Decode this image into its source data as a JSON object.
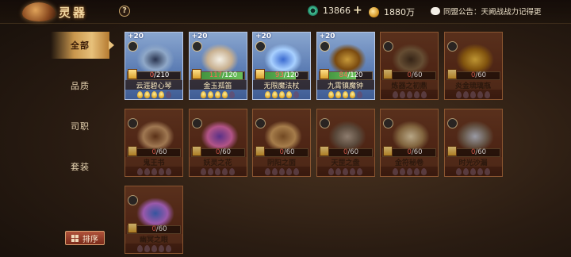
{
  "header": {
    "title": "灵器",
    "help_icon": "?",
    "jade_amount": "13866",
    "gold_amount": "1880万",
    "notice": "同盟公告：天阙战战力记得更"
  },
  "nav": {
    "items": [
      {
        "label": "全部",
        "active": true
      },
      {
        "label": "品质",
        "active": false
      },
      {
        "label": "司职",
        "active": false
      },
      {
        "label": "套装",
        "active": false
      }
    ],
    "sort_label": "排序"
  },
  "cards": [
    {
      "name": "云涯碧心琴",
      "upgrade": "+20",
      "current": "0",
      "max": "210",
      "progress": 0,
      "stars": 5,
      "owned": true,
      "icon": "qin-zither-icon"
    },
    {
      "name": "金玉孤笛",
      "upgrade": "+20",
      "current": "117",
      "max": "120",
      "progress": 0.97,
      "stars": 5,
      "owned": true,
      "icon": "flower-flute-icon"
    },
    {
      "name": "无限魔法杖",
      "upgrade": "+20",
      "current": "93",
      "max": "120",
      "progress": 0.77,
      "stars": 5,
      "owned": true,
      "icon": "magic-staff-icon"
    },
    {
      "name": "九霄镇魔钟",
      "upgrade": "+20",
      "current": "84",
      "max": "120",
      "progress": 0.7,
      "stars": 5,
      "owned": true,
      "icon": "bell-icon"
    },
    {
      "name": "炼器之初鼎",
      "upgrade": "",
      "current": "0",
      "max": "60",
      "progress": 0,
      "stars": 5,
      "owned": false,
      "icon": "cauldron-icon"
    },
    {
      "name": "炎金琉璃瓶",
      "upgrade": "",
      "current": "0",
      "max": "60",
      "progress": 0,
      "stars": 5,
      "owned": false,
      "icon": "gold-vase-icon"
    },
    {
      "name": "鬼王书",
      "upgrade": "",
      "current": "0",
      "max": "60",
      "progress": 0,
      "stars": 5,
      "owned": false,
      "icon": "book-icon"
    },
    {
      "name": "妖灵之花",
      "upgrade": "",
      "current": "0",
      "max": "60",
      "progress": 0,
      "stars": 5,
      "owned": false,
      "icon": "demon-flower-icon"
    },
    {
      "name": "阴阳之面",
      "upgrade": "",
      "current": "0",
      "max": "60",
      "progress": 0,
      "stars": 5,
      "owned": false,
      "icon": "mask-icon"
    },
    {
      "name": "天罡之盘",
      "upgrade": "",
      "current": "0",
      "max": "60",
      "progress": 0,
      "stars": 5,
      "owned": false,
      "icon": "disc-icon"
    },
    {
      "name": "金符秘卷",
      "upgrade": "",
      "current": "0",
      "max": "60",
      "progress": 0,
      "stars": 5,
      "owned": false,
      "icon": "scroll-icon"
    },
    {
      "name": "时光沙漏",
      "upgrade": "",
      "current": "0",
      "max": "60",
      "progress": 0,
      "stars": 5,
      "owned": false,
      "icon": "hourglass-icon"
    },
    {
      "name": "幽冥之眼",
      "upgrade": "",
      "current": "0",
      "max": "60",
      "progress": 0,
      "stars": 5,
      "owned": false,
      "icon": "crystal-orb-icon"
    }
  ]
}
